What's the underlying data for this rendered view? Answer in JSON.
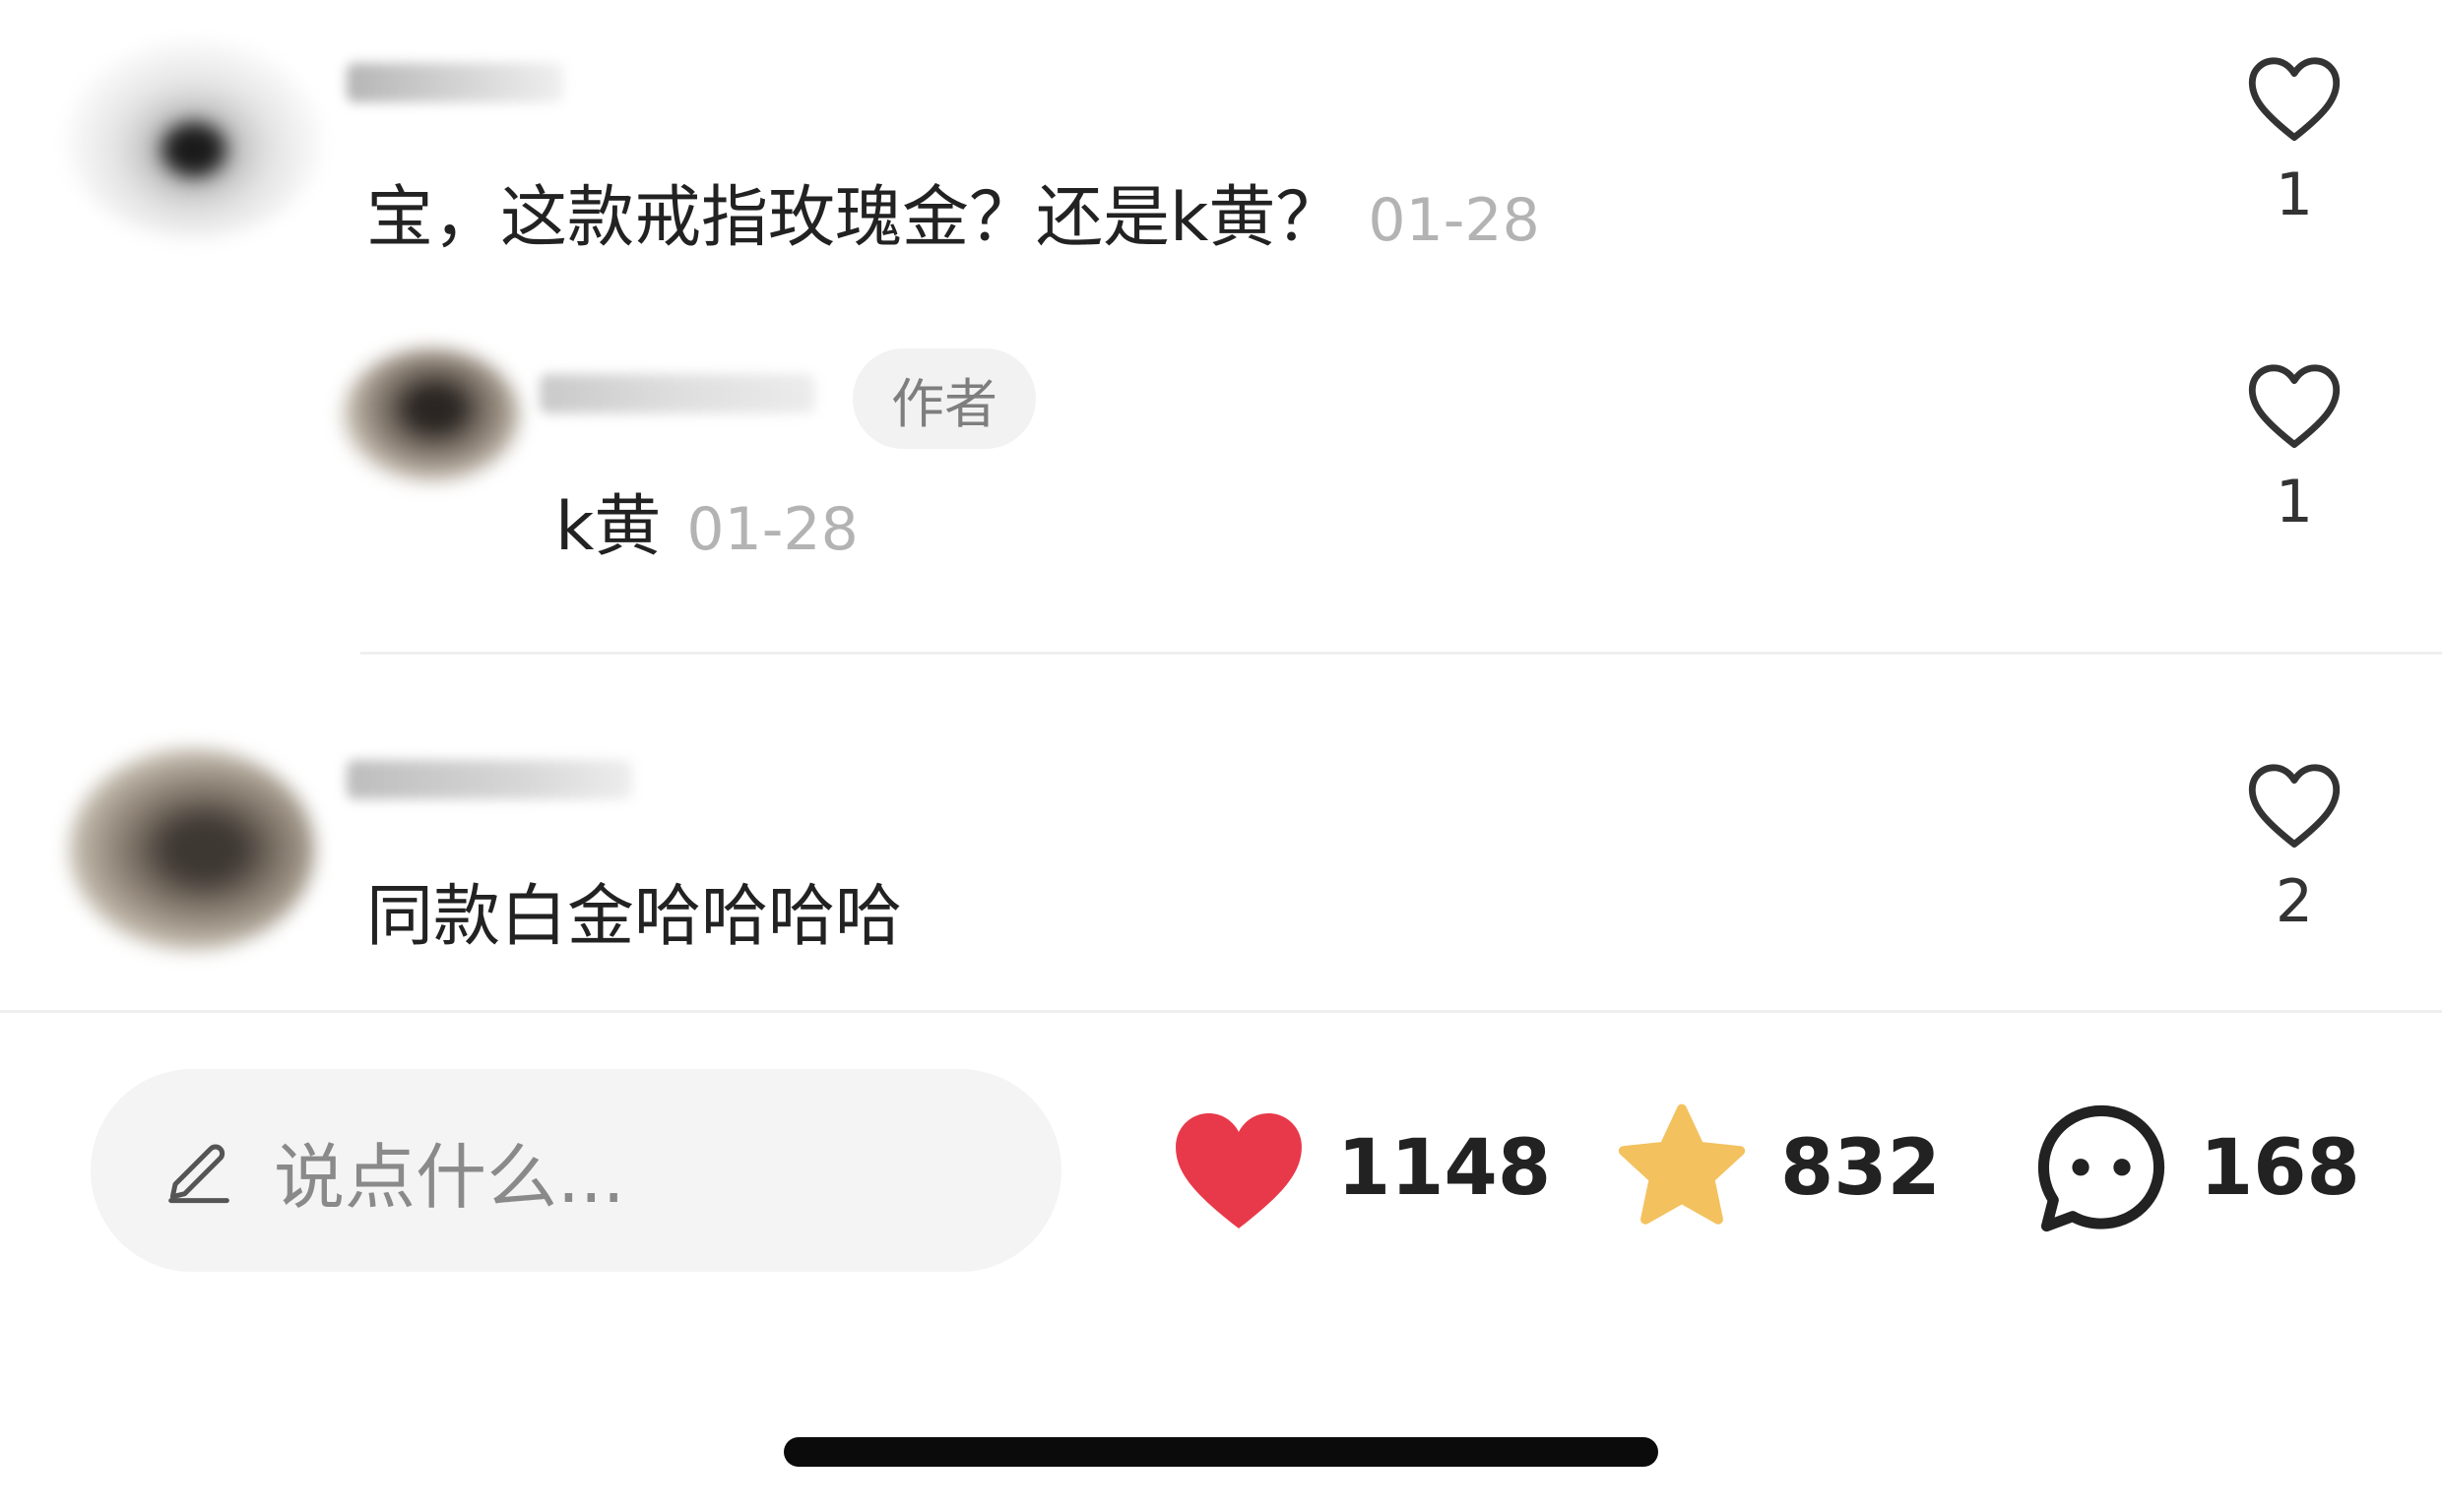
{
  "comments": [
    {
      "text": "宝，这款戒指玫瑰金？还是k黄？",
      "date": "01-28",
      "likes": "1",
      "reply": {
        "author_tag": "作者",
        "text": "k黄",
        "date": "01-28",
        "likes": "1"
      }
    },
    {
      "text": "同款白金哈哈哈哈",
      "likes": "2"
    }
  ],
  "bottom_bar": {
    "input_placeholder": "说点什么...",
    "like_count": "1148",
    "favorite_count": "832",
    "comment_count": "168"
  },
  "colors": {
    "like_red": "#E8394A",
    "star_yellow": "#F3C15E",
    "text_primary": "#222222",
    "text_secondary": "#B3B3B3"
  },
  "icons": [
    "heart-outline-icon",
    "heart-filled-icon",
    "star-filled-icon",
    "comment-bubble-icon",
    "pencil-icon"
  ]
}
